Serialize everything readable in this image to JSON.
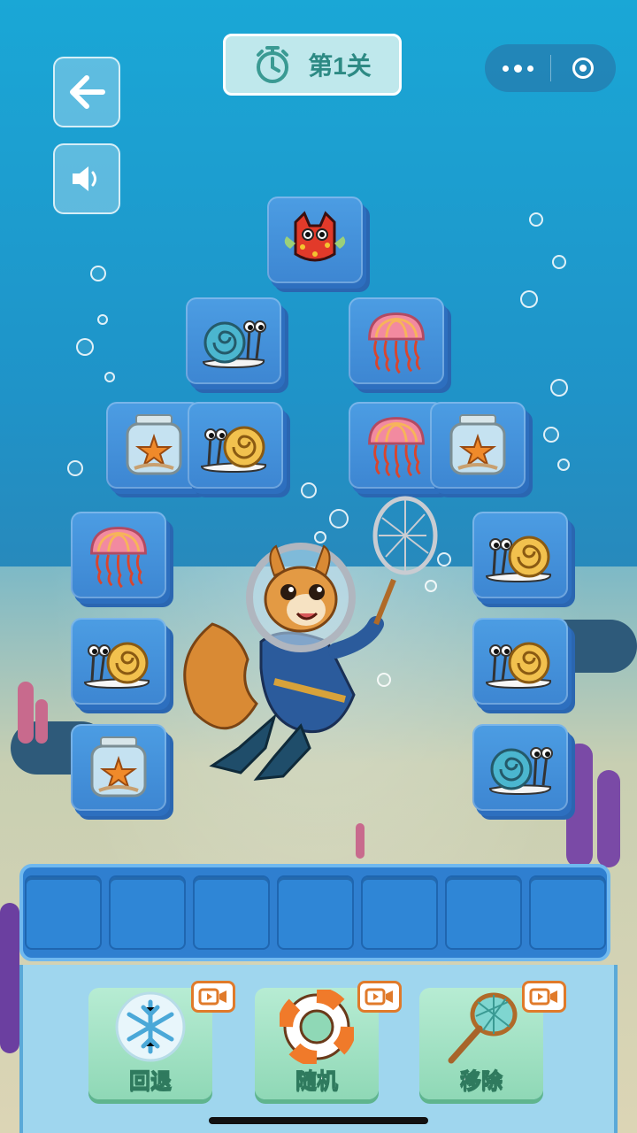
{
  "header": {
    "level_label": "第1关",
    "back_icon": "arrow-left-icon",
    "sound_icon": "speaker-icon",
    "timer_icon": "stopwatch-icon",
    "menu_icon": "more-dots-icon",
    "close_icon": "target-circle-icon"
  },
  "board": {
    "tiles": [
      {
        "item": "red-fish"
      },
      {
        "item": "blue-snail"
      },
      {
        "item": "jellyfish"
      },
      {
        "item": "starfish-jar"
      },
      {
        "item": "yellow-snail"
      },
      {
        "item": "jellyfish"
      },
      {
        "item": "starfish-jar"
      },
      {
        "item": "jellyfish"
      },
      {
        "item": "yellow-snail"
      },
      {
        "item": "yellow-snail"
      },
      {
        "item": "yellow-snail"
      },
      {
        "item": "starfish-jar"
      },
      {
        "item": "blue-snail"
      }
    ]
  },
  "tray": {
    "slot_count": 7,
    "filled": 0
  },
  "tools": [
    {
      "label": "回退",
      "icon": "snowflake-icon",
      "badge": "video-icon"
    },
    {
      "label": "随机",
      "icon": "lifebuoy-icon",
      "badge": "video-icon"
    },
    {
      "label": "移除",
      "icon": "net-icon",
      "badge": "video-icon"
    }
  ],
  "colors": {
    "tile": "#4c9de3",
    "tray": "#2f7fd0",
    "tool": "#9fdcc0",
    "accent": "#e07a2a"
  }
}
